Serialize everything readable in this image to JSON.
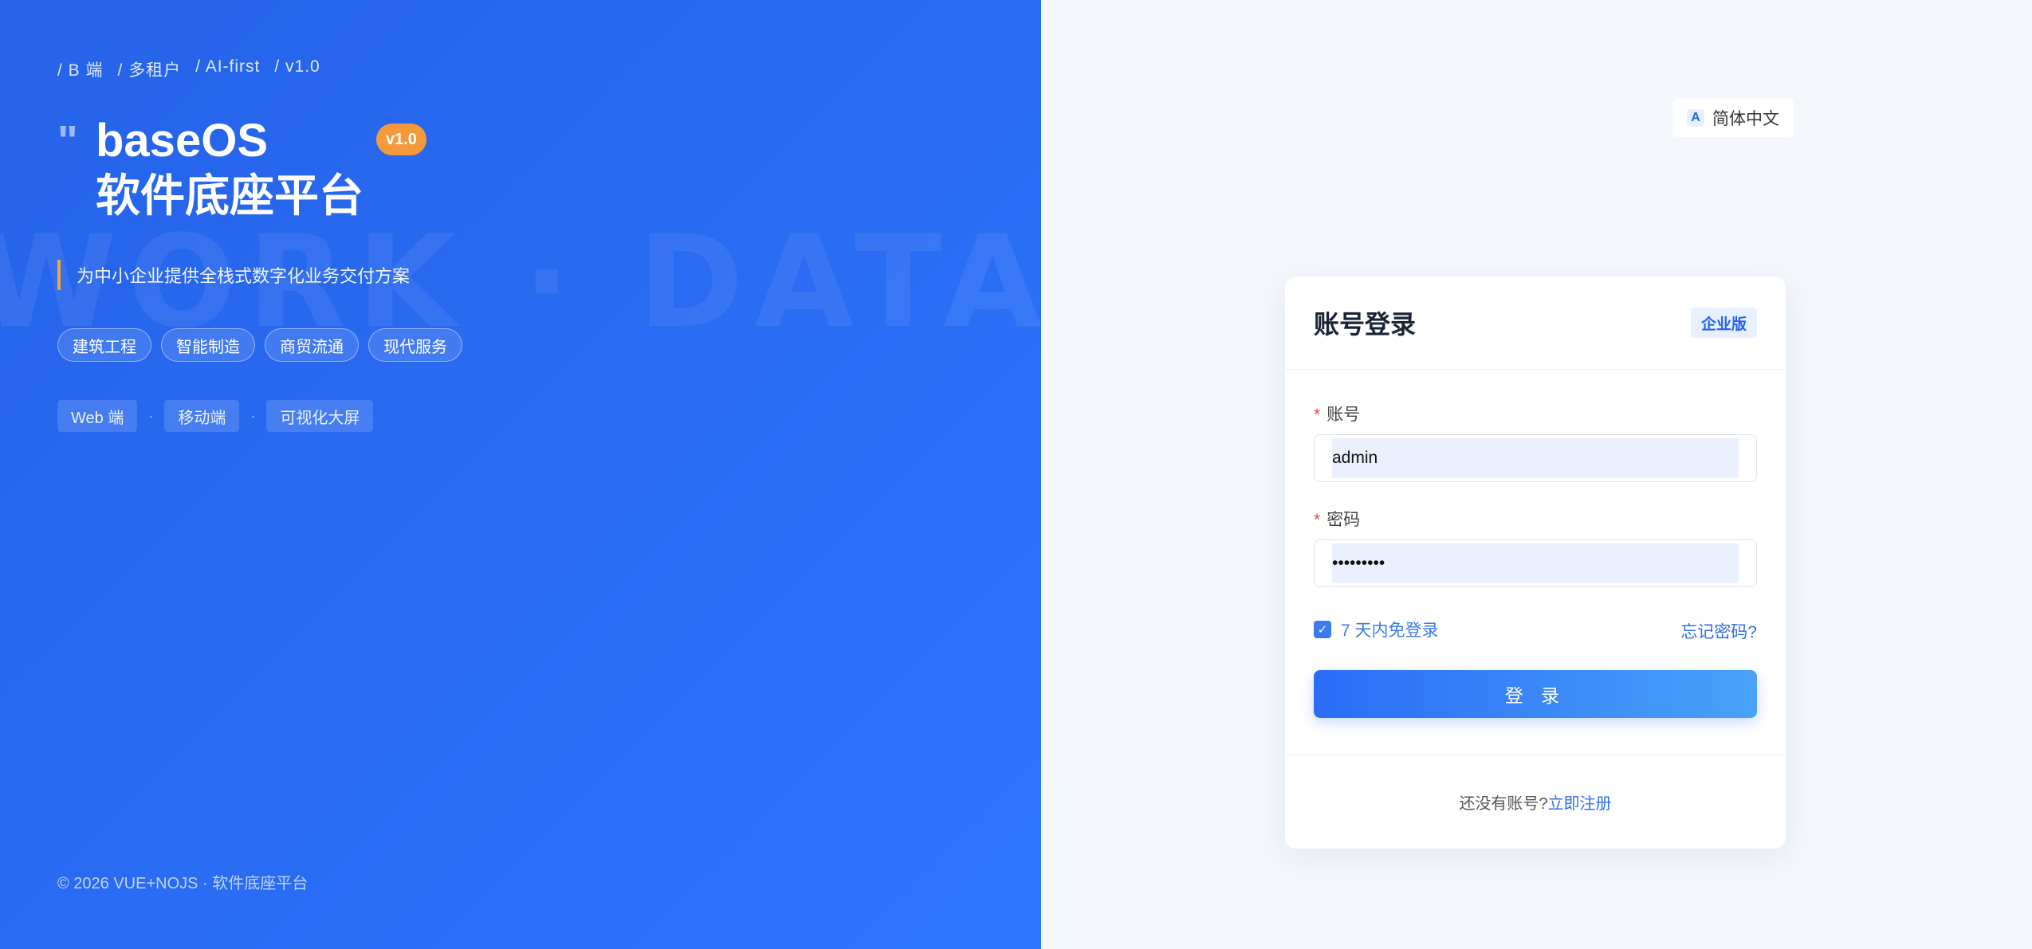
{
  "hero": {
    "breadcrumbs": [
      "B 端",
      "多租户",
      "AI-first",
      "v1.0"
    ],
    "quote": "\"",
    "title": "baseOS",
    "subtitle": "软件底座平台",
    "version_badge": "v1.0",
    "watermark": "WORK · DATA · ",
    "tagline": "为中小企业提供全栈式数字化业务交付方案",
    "industries": [
      "建筑工程",
      "智能制造",
      "商贸流通",
      "现代服务"
    ],
    "platforms": [
      "Web 端",
      "移动端",
      "可视化大屏"
    ],
    "platform_separator": "·",
    "copyright": "© 2026 VUE+NOJS · 软件底座平台",
    "accent_color": "#f5a443"
  },
  "lang": {
    "icon": "A",
    "label": "简体中文"
  },
  "login": {
    "title": "账号登录",
    "edition_badge": "企业版",
    "account_label": "账号",
    "account_value": "admin",
    "password_label": "密码",
    "password_value": "password1",
    "remember_label": "7 天内免登录",
    "remember_checked": true,
    "forgot_label": "忘记密码?",
    "submit_label": "登 录",
    "no_account_text": "还没有账号?",
    "register_link": "立即注册",
    "primary_color": "#2a6cf8"
  }
}
